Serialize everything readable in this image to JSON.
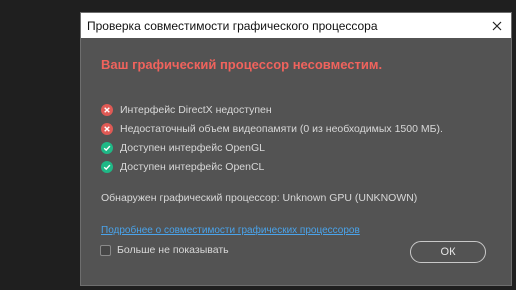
{
  "window": {
    "title": "Проверка совместимости графического процессора",
    "close_icon": "close-icon"
  },
  "heading": "Ваш графический процессор несовместим.",
  "checks": [
    {
      "status": "error",
      "icon": "error-x-icon",
      "text": "Интерфейс DirectX недоступен"
    },
    {
      "status": "error",
      "icon": "error-x-icon",
      "text": "Недостаточный объем видеопамяти (0 из необходимых 1500 МБ)."
    },
    {
      "status": "ok",
      "icon": "checkmark-icon",
      "text": "Доступен интерфейс OpenGL"
    },
    {
      "status": "ok",
      "icon": "checkmark-icon",
      "text": "Доступен интерфейс OpenCL"
    }
  ],
  "detected_gpu": "Обнаружен графический процессор: Unknown GPU (UNKNOWN)",
  "more_link": "Подробнее о совместимости графических процессоров",
  "dont_show": {
    "label": "Больше не показывать",
    "checked": false
  },
  "ok_label": "ОК",
  "colors": {
    "error": "#e05a55",
    "ok": "#1fb886",
    "heading": "#f0635d",
    "link": "#4aa3ea",
    "dialog_bg": "#535353"
  }
}
